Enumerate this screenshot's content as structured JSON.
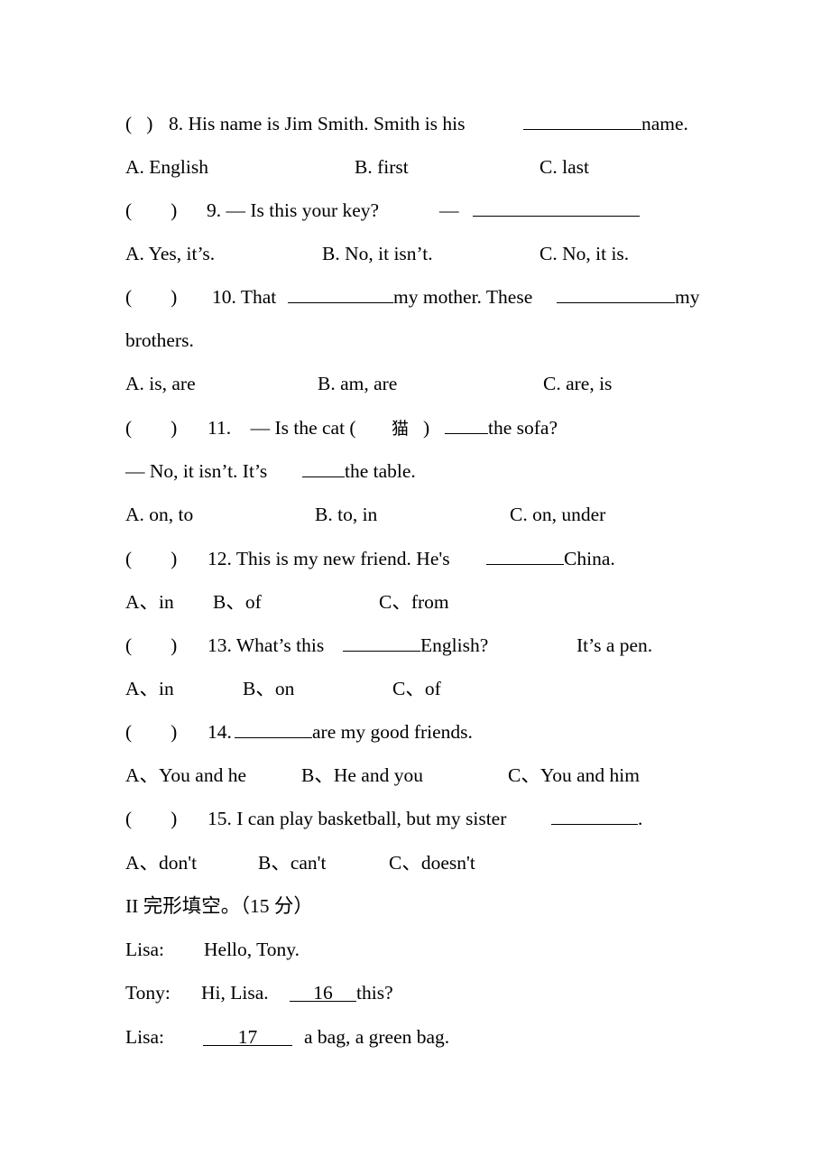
{
  "document": {
    "questions": [
      {
        "number": "8",
        "paren": "(   )",
        "stem_before": "8. His name is Jim Smith. Smith is his",
        "stem_after": "name.",
        "options": [
          "A. English",
          "B. first",
          "C. last"
        ]
      },
      {
        "number": "9",
        "paren": "(        )",
        "stem_before": "9. — Is this your key?",
        "dash": "—",
        "options": [
          "A. Yes, it’s.",
          "B. No, it isn’t.",
          "C. No, it is."
        ]
      },
      {
        "number": "10",
        "paren": "(        )",
        "stem_part1": "10. That",
        "stem_part2": "my mother. These",
        "stem_part3": "my",
        "stem_cont": "brothers.",
        "options": [
          "A. is, are",
          "B. am, are",
          "C. are, is"
        ]
      },
      {
        "number": "11",
        "paren": "(        )",
        "stem_part1": "11.    — Is the cat (",
        "cjk_word": "猫",
        "stem_part2": ")",
        "stem_part3": "the sofa?",
        "reply_before": "— No, it isn’t. It’s",
        "reply_after": "the table.",
        "options": [
          "A. on, to",
          "B. to, in",
          "C. on, under"
        ]
      },
      {
        "number": "12",
        "paren": "(        )",
        "stem_before": "12. This is my new friend. He's",
        "stem_after": "China.",
        "options": [
          "A、in",
          "B、of",
          "C、from"
        ]
      },
      {
        "number": "13",
        "paren": "(        )",
        "stem_before": "13. What’s this",
        "stem_after": "English?",
        "answer_hint": "It’s a pen.",
        "options": [
          "A、in",
          "B、on",
          "C、of"
        ]
      },
      {
        "number": "14",
        "paren": "(        )",
        "stem_before": "14.",
        "stem_after": "are my good friends.",
        "options": [
          "A、You and he",
          "B、He and you",
          "C、You and him"
        ]
      },
      {
        "number": "15",
        "paren": "(        )",
        "stem_before": "15. I can play basketball, but my sister",
        "stem_after": ".",
        "options": [
          "A、don't",
          "B、can't",
          "C、doesn't"
        ]
      }
    ],
    "section_ii": {
      "title": "II 完形填空。（15 分）",
      "dialogue": [
        {
          "speaker": "Lisa:",
          "before": "Hello, Tony.",
          "blank": "",
          "after": ""
        },
        {
          "speaker": "Tony:",
          "before": "Hi, Lisa.",
          "blank": "16",
          "after": "this?"
        },
        {
          "speaker": "Lisa:",
          "before": "",
          "blank": "17",
          "after": "a bag, a green bag."
        }
      ]
    }
  }
}
